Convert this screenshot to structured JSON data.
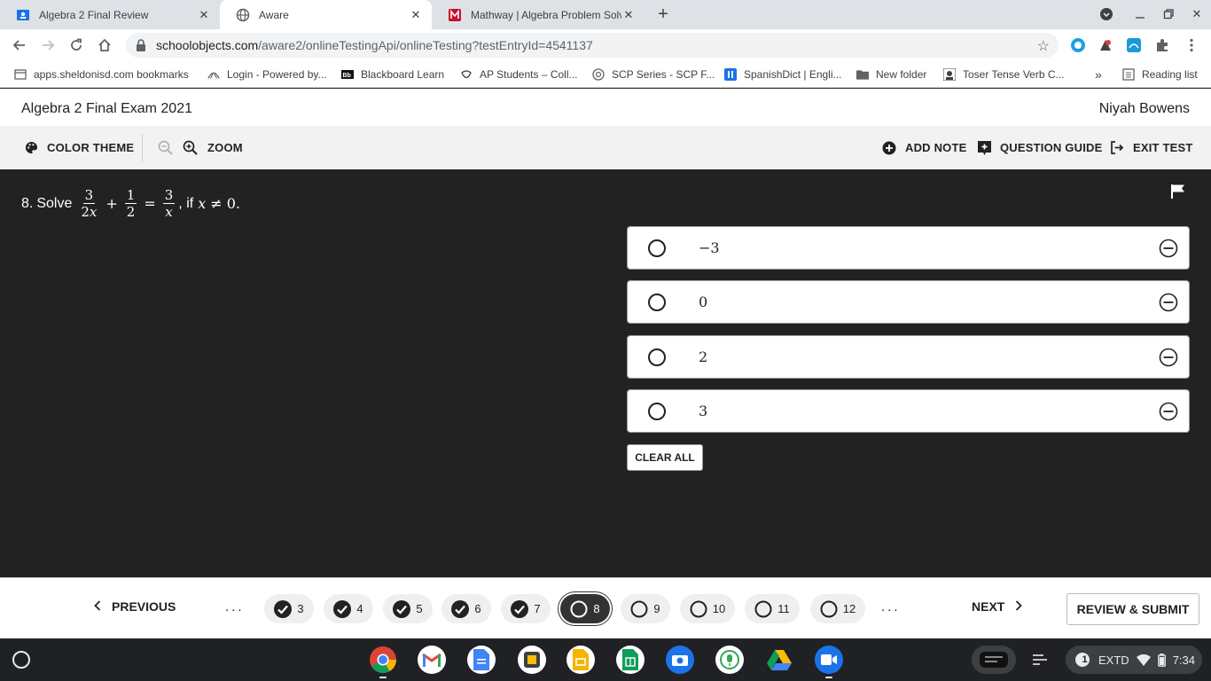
{
  "browser": {
    "tabs": [
      {
        "title": "Algebra 2 Final Review",
        "active": false
      },
      {
        "title": "Aware",
        "active": true
      },
      {
        "title": "Mathway | Algebra Problem Solver",
        "active": false
      }
    ],
    "url_host": "schoolobjects.com",
    "url_path": "/aware2/onlineTestingApi/onlineTesting?testEntryId=4541137",
    "bookmarks": [
      "apps.sheldonisd.com bookmarks",
      "Login - Powered by...",
      "Blackboard Learn",
      "AP Students – Coll...",
      "SCP Series - SCP F...",
      "SpanishDict | Engli...",
      "New folder",
      "Toser Tense Verb C..."
    ],
    "more_bookmarks": "»",
    "reading_list": "Reading list"
  },
  "exam": {
    "title": "Algebra 2 Final Exam 2021",
    "student": "Niyah Bowens"
  },
  "toolbar": {
    "color_theme": "COLOR THEME",
    "zoom": "ZOOM",
    "add_note": "ADD NOTE",
    "question_guide": "QUESTION GUIDE",
    "exit_test": "EXIT TEST"
  },
  "question": {
    "number": "8.",
    "prefix": "Solve",
    "frac1_num": "3",
    "frac1_den_coef": "2",
    "frac1_den_var": "x",
    "plus": "+",
    "frac2_num": "1",
    "frac2_den": "2",
    "equals": "=",
    "frac3_num": "3",
    "frac3_den": "x",
    "comma_if": ", if",
    "cond_var": "x",
    "cond_rest": "≠ 0."
  },
  "choices": [
    {
      "value": "−3"
    },
    {
      "value": "0"
    },
    {
      "value": "2"
    },
    {
      "value": "3"
    }
  ],
  "clear_all": "CLEAR ALL",
  "navigation": {
    "previous": "PREVIOUS",
    "next": "NEXT",
    "ellipsis": "...",
    "questions": [
      {
        "n": "3",
        "answered": true
      },
      {
        "n": "4",
        "answered": true
      },
      {
        "n": "5",
        "answered": true
      },
      {
        "n": "6",
        "answered": true
      },
      {
        "n": "7",
        "answered": true
      },
      {
        "n": "8",
        "answered": false,
        "current": true
      },
      {
        "n": "9",
        "answered": false
      },
      {
        "n": "10",
        "answered": false
      },
      {
        "n": "11",
        "answered": false
      },
      {
        "n": "12",
        "answered": false
      }
    ],
    "review_submit": "REVIEW & SUBMIT"
  },
  "shelf": {
    "apps": [
      "chrome-icon",
      "gmail-icon",
      "docs-icon",
      "screencast-icon",
      "slides-icon",
      "sheets-icon",
      "camera-icon",
      "voice-icon",
      "drive-icon",
      "meet-icon"
    ],
    "notification_count": "1",
    "display_label": "EXTD",
    "time": "7:34"
  },
  "colors": {
    "stage_bg": "#222222",
    "toolbar_bg": "#f2f2f2",
    "shelf_bg": "#202124"
  }
}
